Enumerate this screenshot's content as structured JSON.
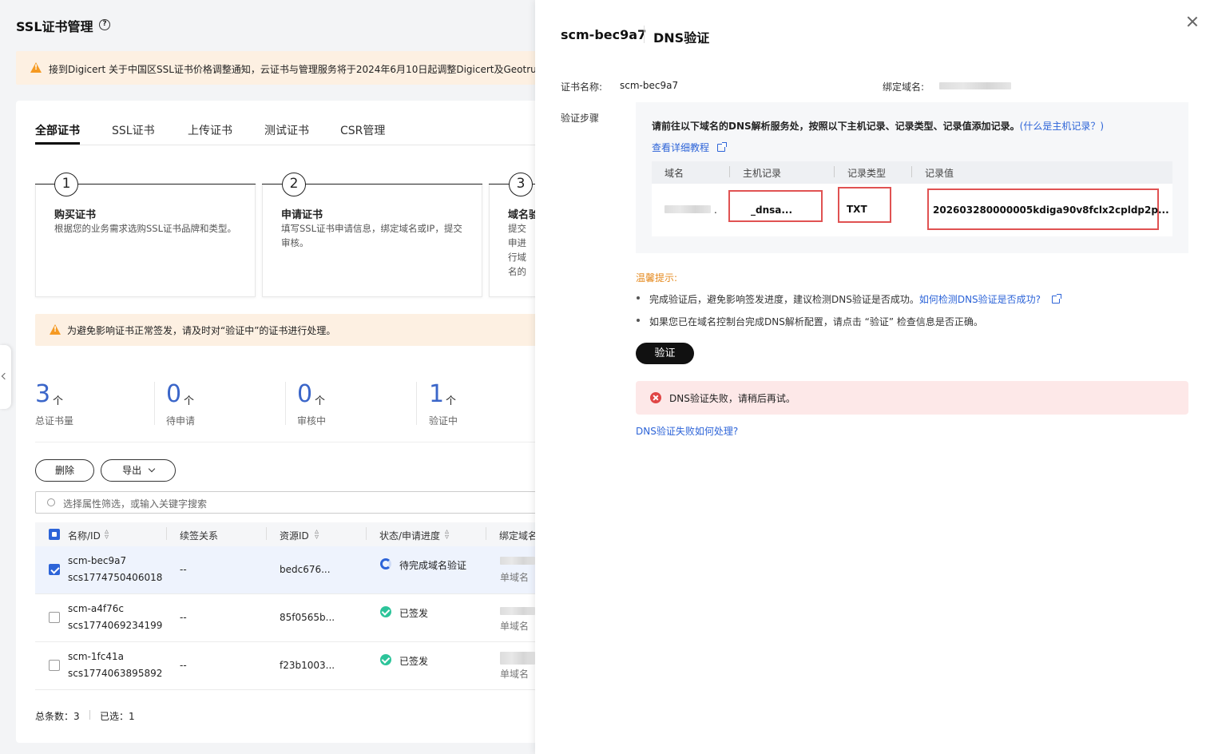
{
  "page": {
    "title": "SSL证书管理",
    "notice_top": "接到Digicert 关于中国区SSL证书价格调整通知，云证书与管理服务将于2024年6月10日起调整Digicert及Geotrust品",
    "tabs": [
      "全部证书",
      "SSL证书",
      "上传证书",
      "测试证书",
      "CSR管理"
    ],
    "steps": [
      {
        "num": "1",
        "title": "购买证书",
        "desc": "根据您的业务需求选购SSL证书品牌和类型。"
      },
      {
        "num": "2",
        "title": "申请证书",
        "desc": "填写SSL证书申请信息，绑定域名或IP，提交审核。"
      },
      {
        "num": "3",
        "title": "域名验",
        "desc": "提交申进行域名的所知，可"
      }
    ],
    "notice_mid": "为避免影响证书正常签发，请及时对“验证中”的证书进行处理。",
    "stats": [
      {
        "value": "3",
        "unit": "个",
        "label": "总证书量"
      },
      {
        "value": "0",
        "unit": "个",
        "label": "待申请"
      },
      {
        "value": "0",
        "unit": "个",
        "label": "审核中"
      },
      {
        "value": "1",
        "unit": "个",
        "label": "验证中"
      }
    ],
    "delete_label": "删除",
    "export_label": "导出",
    "search_placeholder": "选择属性筛选，或输入关键字搜索",
    "columns": [
      "名称/ID",
      "续签关系",
      "资源ID",
      "状态/申请进度",
      "绑定域名"
    ],
    "rows": [
      {
        "name": "scm-bec9a7",
        "id": "scs1774750406018",
        "renew": "--",
        "resource": "bedc676...",
        "status": "待完成域名验证",
        "domain_type": "单域名",
        "selected": true
      },
      {
        "name": "scm-a4f76c",
        "id": "scs1774069234199",
        "renew": "--",
        "resource": "85f0565b...",
        "status": "已签发",
        "domain_type": "单域名",
        "selected": false
      },
      {
        "name": "scm-1fc41a",
        "id": "scs1774063895892",
        "renew": "--",
        "resource": "f23b1003...",
        "status": "已签发",
        "domain_type": "单域名",
        "selected": false
      }
    ],
    "footer_total": "总条数：3",
    "footer_selected": "已选：1"
  },
  "drawer": {
    "cert_name": "scm-bec9a7",
    "title": "DNS验证",
    "cert_label": "证书名称:",
    "cert_value": "scm-bec9a7",
    "domain_label": "绑定域名:",
    "steps_label": "验证步骤",
    "instruction": "请前往以下域名的DNS解析服务处，按照以下主机记录、记录类型、记录值添加记录。",
    "what_is_link": "(什么是主机记录？)",
    "tutorial_link": "查看详细教程",
    "dns_columns": [
      "域名",
      "主机记录",
      "记录类型",
      "记录值"
    ],
    "dns_row": {
      "host": "_dnsa...",
      "type": "TXT",
      "value": "202603280000005kdiga90v8fclx2cpldp2p..."
    },
    "tips_title": "温馨提示:",
    "tip1": "完成验证后，避免影响签发进度，建议检测DNS验证是否成功。",
    "tip1_link": "如何检测DNS验证是否成功?",
    "tip2": "如果您已在域名控制台完成DNS解析配置，请点击 “验证” 检查信息是否正确。",
    "verify_label": "验证",
    "error_text": "DNS验证失败，请稍后再试。",
    "fail_help_link": "DNS验证失败如何处理?"
  },
  "colors": {
    "accent": "#2d64d8",
    "warning": "#f59a23",
    "error": "#e04646",
    "highlight": "#e05252"
  }
}
